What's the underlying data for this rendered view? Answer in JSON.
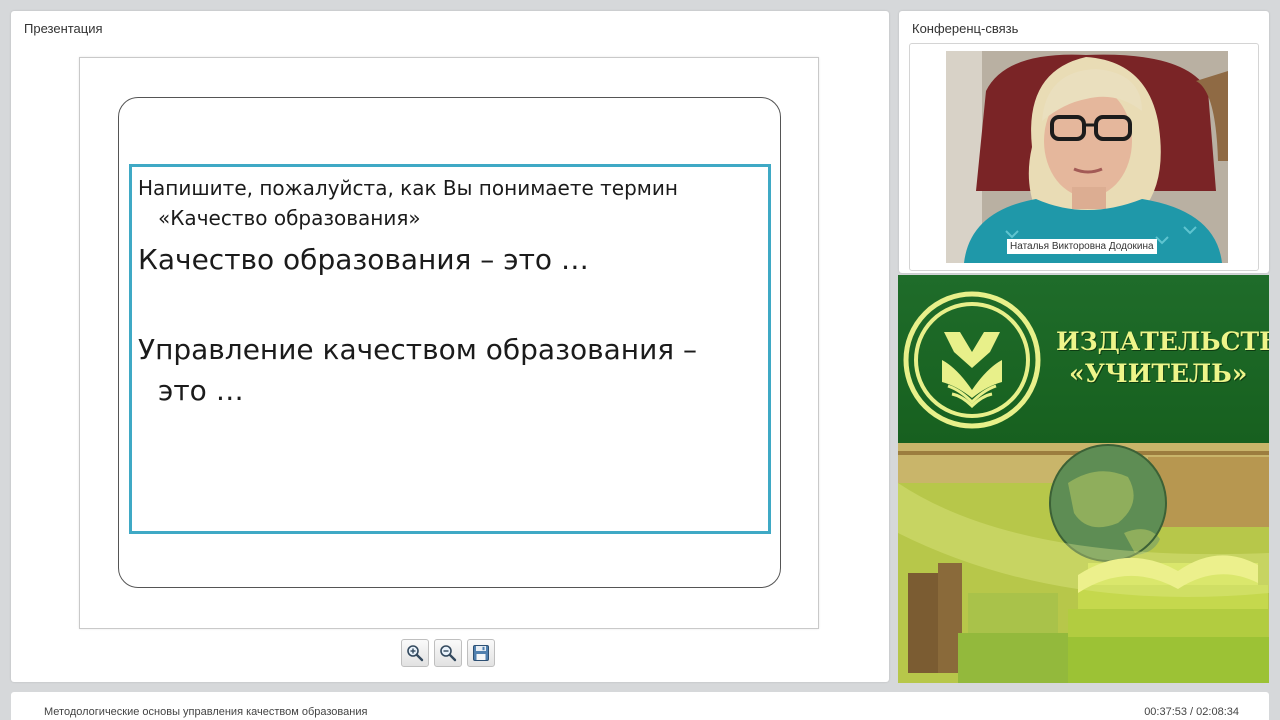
{
  "presentation": {
    "title": "Презентация",
    "slide": {
      "question_line1": "Напишите, пожалуйста, как Вы понимаете термин",
      "question_line2": "«Качество образования»",
      "item1": "Качество образования – это …",
      "item2_line1": "Управление качеством образования –",
      "item2_line2": "это …"
    },
    "toolbar": {
      "zoom_in_icon": "zoom-in-icon",
      "zoom_out_icon": "zoom-out-icon",
      "save_icon": "floppy-disk-icon"
    }
  },
  "conference": {
    "title": "Конференц-связь",
    "participant_name": "Наталья Викторовна Додокина"
  },
  "banner": {
    "line1": "ИЗДАТЕЛЬСТВО",
    "line2": "«УЧИТЕЛЬ»"
  },
  "footer": {
    "course_title": "Методологические основы управления качеством образования",
    "time": "00:37:53 / 02:08:34"
  },
  "colors": {
    "accent": "#3fa9c5",
    "banner_green": "#1b6625",
    "banner_text": "#eef58a"
  }
}
